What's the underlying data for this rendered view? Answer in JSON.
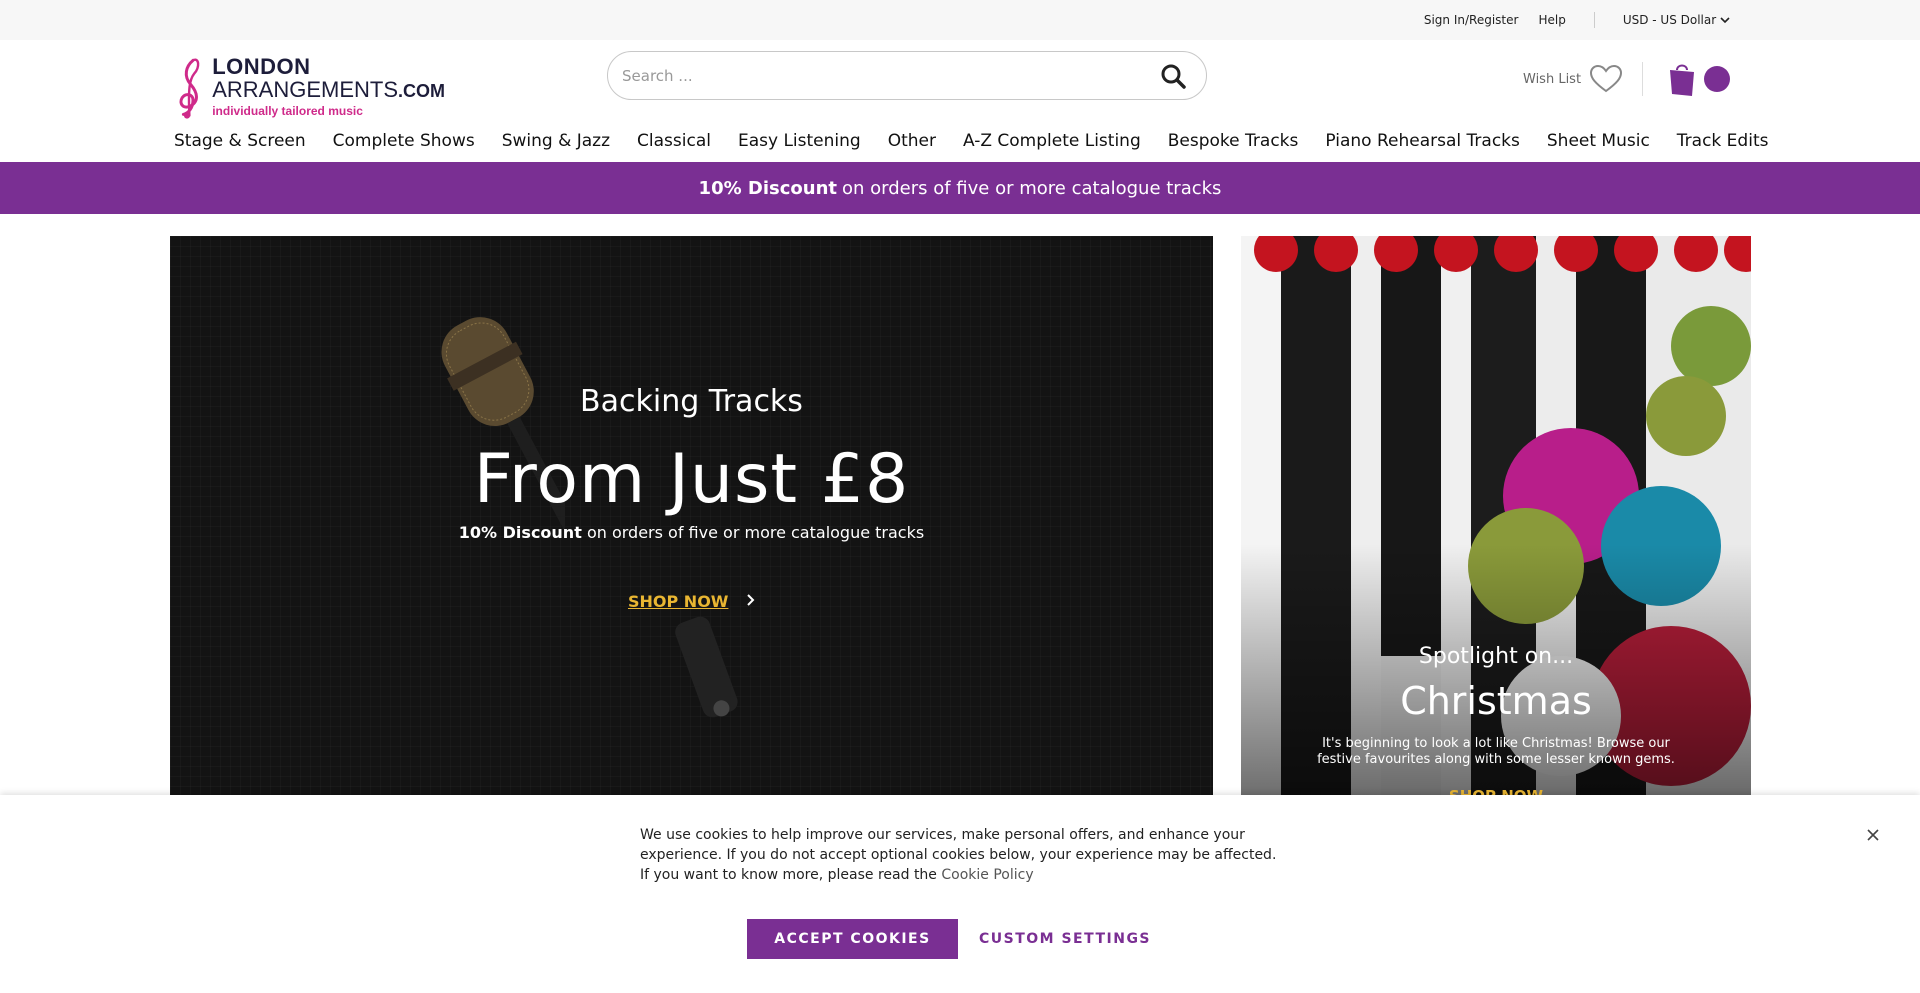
{
  "topbar": {
    "signin": "Sign In/Register",
    "help": "Help",
    "currency": "USD - US Dollar"
  },
  "logo": {
    "line1": "LONDON",
    "line2": "ARRANGEMENTS",
    "line2_suffix": ".COM",
    "tagline": "individually tailored music"
  },
  "search": {
    "placeholder": "Search ..."
  },
  "header": {
    "wishlist": "Wish List"
  },
  "nav": {
    "items": [
      {
        "label": "Stage & Screen"
      },
      {
        "label": "Complete Shows"
      },
      {
        "label": "Swing & Jazz"
      },
      {
        "label": "Classical"
      },
      {
        "label": "Easy Listening"
      },
      {
        "label": "Other"
      },
      {
        "label": "A-Z Complete Listing"
      },
      {
        "label": "Bespoke Tracks"
      },
      {
        "label": "Piano Rehearsal Tracks"
      },
      {
        "label": "Sheet Music"
      },
      {
        "label": "Track Edits"
      }
    ]
  },
  "promo": {
    "bold": "10% Discount",
    "rest": "on orders of five or more catalogue tracks"
  },
  "hero": {
    "line1": "Backing Tracks",
    "line2": "From Just £8",
    "discount_bold": "10% Discount",
    "discount_rest": "on orders of five or more catalogue tracks",
    "cta": "SHOP NOW"
  },
  "spotlight": {
    "kicker": "Spotlight on...",
    "title": "Christmas",
    "body": "It's beginning to look a lot like Christmas! Browse our festive favourites along with some lesser known gems.",
    "cta": "SHOP NOW"
  },
  "cookie": {
    "text": "We use cookies to help improve our services, make personal offers, and enhance your experience. If you do not accept optional cookies below, your experience may be affected. If you want to know more, please read the",
    "link": "Cookie Policy",
    "accept": "ACCEPT COOKIES",
    "custom": "CUSTOM SETTINGS"
  },
  "colors": {
    "brand_purple": "#7a2f93",
    "cta_gold": "#e9b632",
    "logo_pink": "#cf2a8a"
  }
}
